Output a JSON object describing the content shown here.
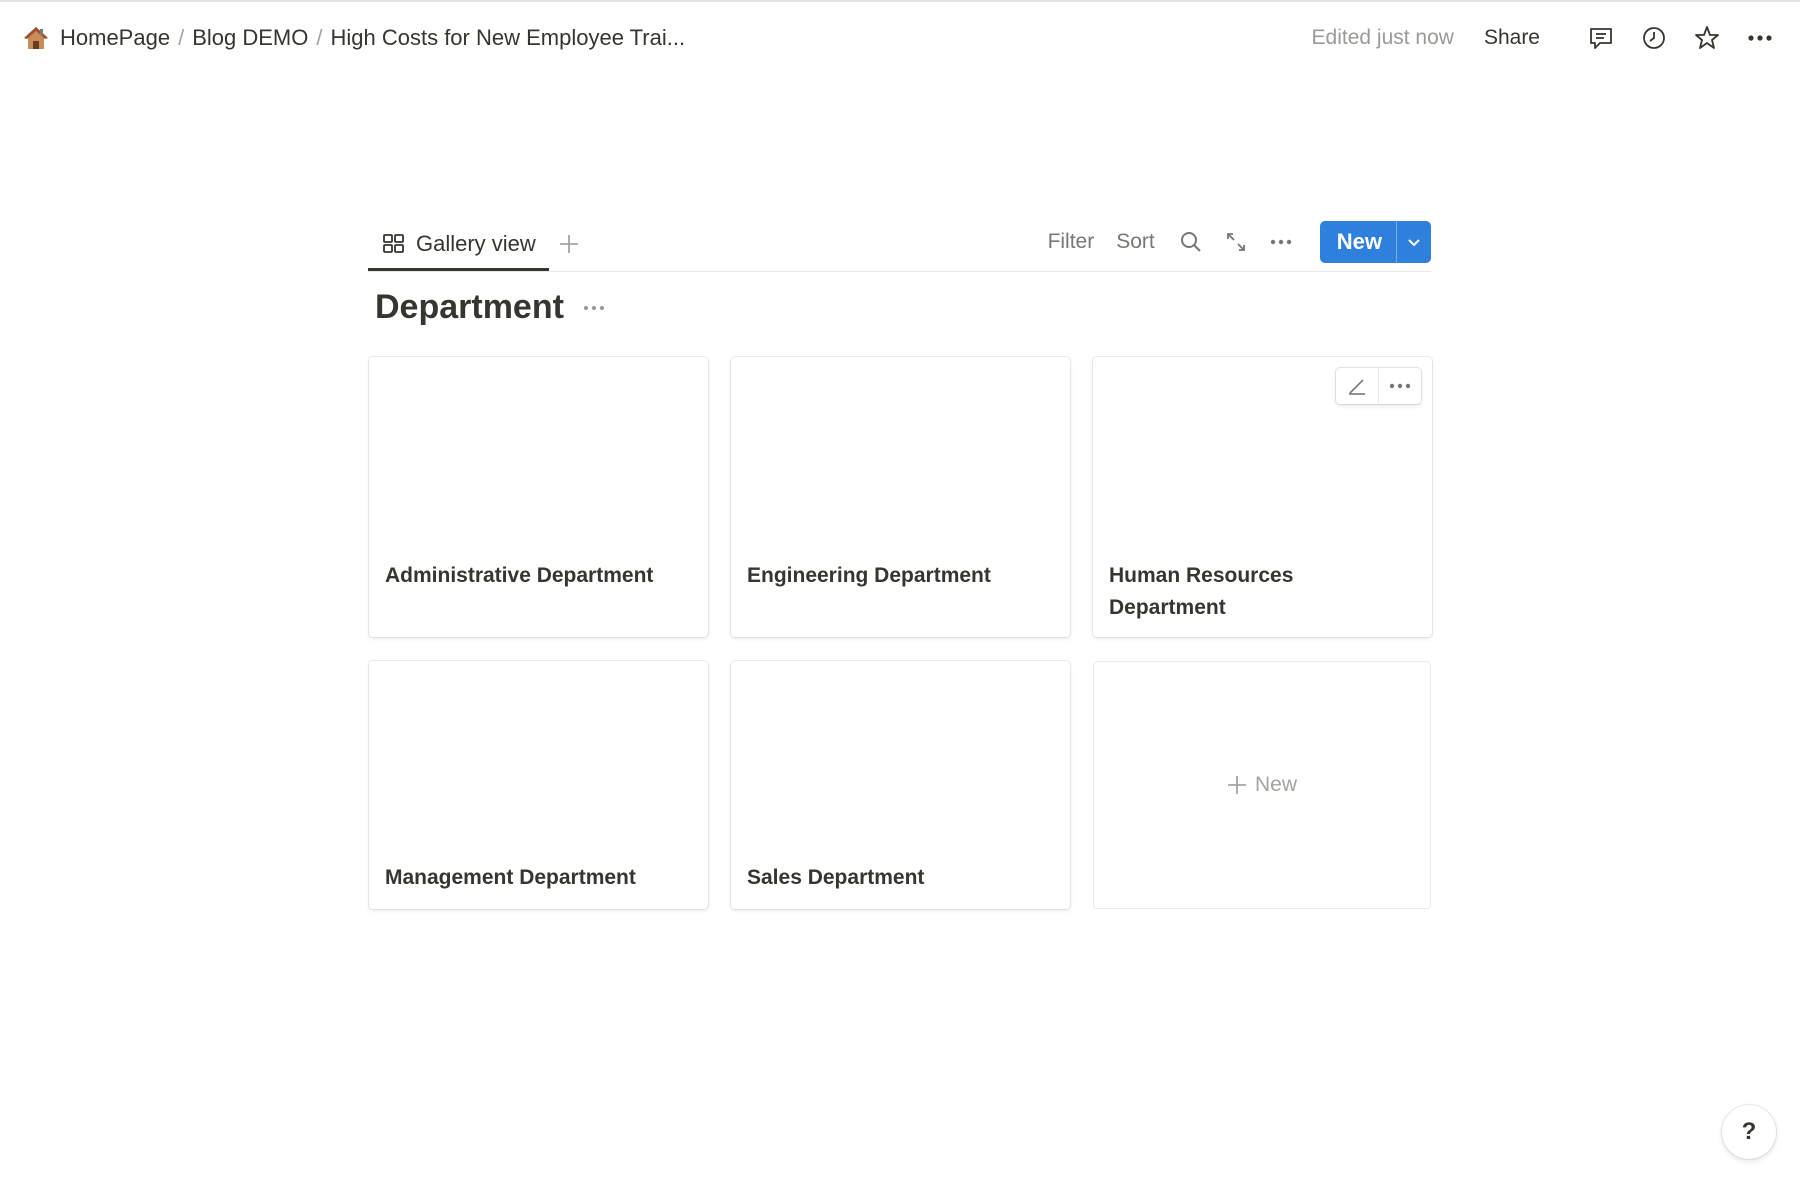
{
  "header": {
    "breadcrumbs": [
      "HomePage",
      "Blog DEMO",
      "High Costs for New Employee Trai..."
    ],
    "breadcrumb_separator": "/",
    "edited_status": "Edited just now",
    "share_label": "Share",
    "icons": [
      "comments-icon",
      "clock-icon",
      "star-icon",
      "more-icon"
    ]
  },
  "view": {
    "tab_label": "Gallery view",
    "filter_label": "Filter",
    "sort_label": "Sort",
    "new_label": "New",
    "accent_color": "#2f80dd"
  },
  "database": {
    "title": "Department",
    "cards": [
      {
        "name": "Administrative Department"
      },
      {
        "name": "Engineering Department"
      },
      {
        "name": "Human Resources Department"
      },
      {
        "name": "Management Department"
      },
      {
        "name": "Sales Department"
      }
    ],
    "new_card_label": "New"
  },
  "help_label": "?"
}
